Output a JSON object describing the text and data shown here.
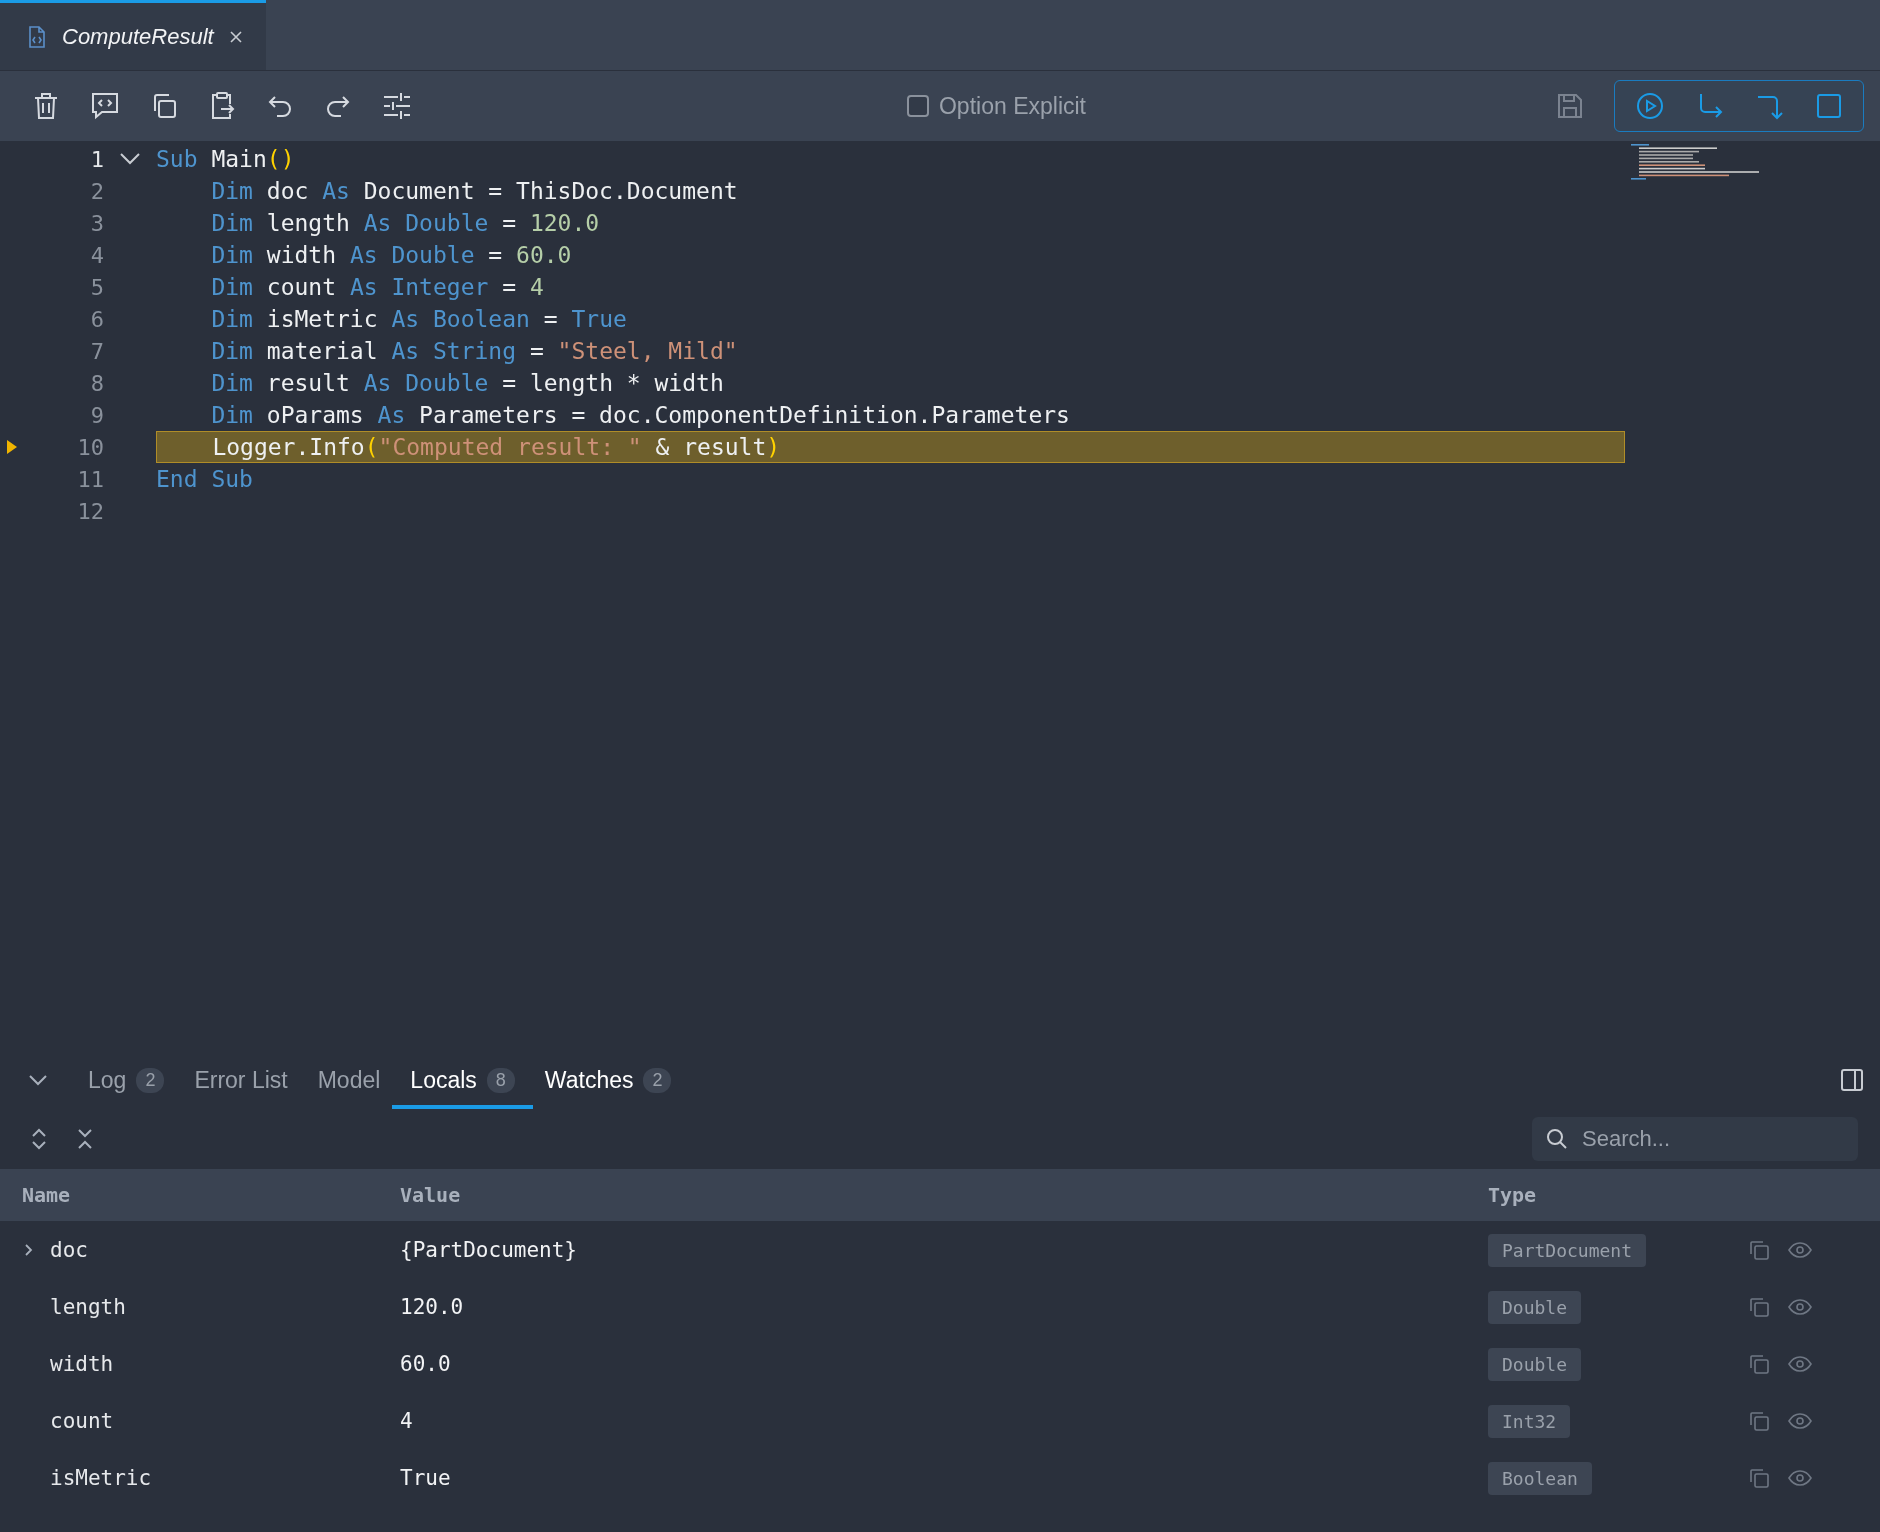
{
  "editor_tabs": [
    {
      "title": "ComputeResult",
      "selected": true
    }
  ],
  "toolbar": {
    "option_explicit": {
      "label": "Option Explicit",
      "checked": false
    }
  },
  "code": {
    "lines": [
      {
        "number": "1",
        "fold": true,
        "current": false,
        "tokens": [
          {
            "t": "Sub ",
            "kind": "kw"
          },
          {
            "t": "Main",
            "kind": "id"
          },
          {
            "t": "()",
            "kind": "paren"
          }
        ]
      },
      {
        "number": "2",
        "fold": false,
        "current": false,
        "tokens": [
          {
            "t": "    Dim ",
            "kind": "kw"
          },
          {
            "t": "doc ",
            "kind": "id"
          },
          {
            "t": "As ",
            "kind": "kw"
          },
          {
            "t": "Document = ThisDoc.Document",
            "kind": "id"
          }
        ]
      },
      {
        "number": "3",
        "fold": false,
        "current": false,
        "tokens": [
          {
            "t": "    Dim ",
            "kind": "kw"
          },
          {
            "t": "length ",
            "kind": "id"
          },
          {
            "t": "As Double ",
            "kind": "kw"
          },
          {
            "t": "= ",
            "kind": "id"
          },
          {
            "t": "120.0",
            "kind": "num"
          }
        ]
      },
      {
        "number": "4",
        "fold": false,
        "current": false,
        "tokens": [
          {
            "t": "    Dim ",
            "kind": "kw"
          },
          {
            "t": "width ",
            "kind": "id"
          },
          {
            "t": "As Double ",
            "kind": "kw"
          },
          {
            "t": "= ",
            "kind": "id"
          },
          {
            "t": "60.0",
            "kind": "num"
          }
        ]
      },
      {
        "number": "5",
        "fold": false,
        "current": false,
        "tokens": [
          {
            "t": "    Dim ",
            "kind": "kw"
          },
          {
            "t": "count ",
            "kind": "id"
          },
          {
            "t": "As Integer ",
            "kind": "kw"
          },
          {
            "t": "= ",
            "kind": "id"
          },
          {
            "t": "4",
            "kind": "num"
          }
        ]
      },
      {
        "number": "6",
        "fold": false,
        "current": false,
        "tokens": [
          {
            "t": "    Dim ",
            "kind": "kw"
          },
          {
            "t": "isMetric ",
            "kind": "id"
          },
          {
            "t": "As Boolean ",
            "kind": "kw"
          },
          {
            "t": "= ",
            "kind": "id"
          },
          {
            "t": "True",
            "kind": "kw"
          }
        ]
      },
      {
        "number": "7",
        "fold": false,
        "current": false,
        "tokens": [
          {
            "t": "    Dim ",
            "kind": "kw"
          },
          {
            "t": "material ",
            "kind": "id"
          },
          {
            "t": "As String ",
            "kind": "kw"
          },
          {
            "t": "= ",
            "kind": "id"
          },
          {
            "t": "\"Steel, Mild\"",
            "kind": "str"
          }
        ]
      },
      {
        "number": "8",
        "fold": false,
        "current": false,
        "tokens": [
          {
            "t": "    Dim ",
            "kind": "kw"
          },
          {
            "t": "result ",
            "kind": "id"
          },
          {
            "t": "As Double ",
            "kind": "kw"
          },
          {
            "t": "= length * width",
            "kind": "id"
          }
        ]
      },
      {
        "number": "9",
        "fold": false,
        "current": false,
        "tokens": [
          {
            "t": "    Dim ",
            "kind": "kw"
          },
          {
            "t": "oParams ",
            "kind": "id"
          },
          {
            "t": "As ",
            "kind": "kw"
          },
          {
            "t": "Parameters = doc.ComponentDefinition.Parameters",
            "kind": "id"
          }
        ]
      },
      {
        "number": "10",
        "fold": false,
        "current": true,
        "tokens": [
          {
            "t": "    Logger.Info",
            "kind": "id"
          },
          {
            "t": "(",
            "kind": "paren"
          },
          {
            "t": "\"Computed result: \"",
            "kind": "str"
          },
          {
            "t": " & result",
            "kind": "id"
          },
          {
            "t": ")",
            "kind": "paren"
          }
        ]
      },
      {
        "number": "11",
        "fold": false,
        "current": false,
        "tokens": [
          {
            "t": "End Sub",
            "kind": "kw"
          }
        ]
      },
      {
        "number": "12",
        "fold": false,
        "current": false
      }
    ]
  },
  "bottom_panel": {
    "tabs": [
      {
        "label": "Log",
        "count": "2",
        "selected": false,
        "bright": false
      },
      {
        "label": "Error List",
        "selected": false,
        "bright": false
      },
      {
        "label": "Model",
        "selected": false,
        "bright": false
      },
      {
        "label": "Locals",
        "count": "8",
        "selected": true,
        "bright": true
      },
      {
        "label": "Watches",
        "count": "2",
        "selected": false,
        "bright": true
      }
    ],
    "search": {
      "placeholder": "Search..."
    },
    "locals": {
      "columns": [
        "Name",
        "Value",
        "Type"
      ],
      "rows": [
        {
          "name": "doc",
          "value": "{PartDocument}",
          "type": "PartDocument",
          "expandable": true
        },
        {
          "name": "length",
          "value": "120.0",
          "type": "Double",
          "expandable": false
        },
        {
          "name": "width",
          "value": "60.0",
          "type": "Double",
          "expandable": false
        },
        {
          "name": "count",
          "value": "4",
          "type": "Int32",
          "expandable": false
        },
        {
          "name": "isMetric",
          "value": "True",
          "type": "Boolean",
          "expandable": false
        }
      ]
    }
  }
}
